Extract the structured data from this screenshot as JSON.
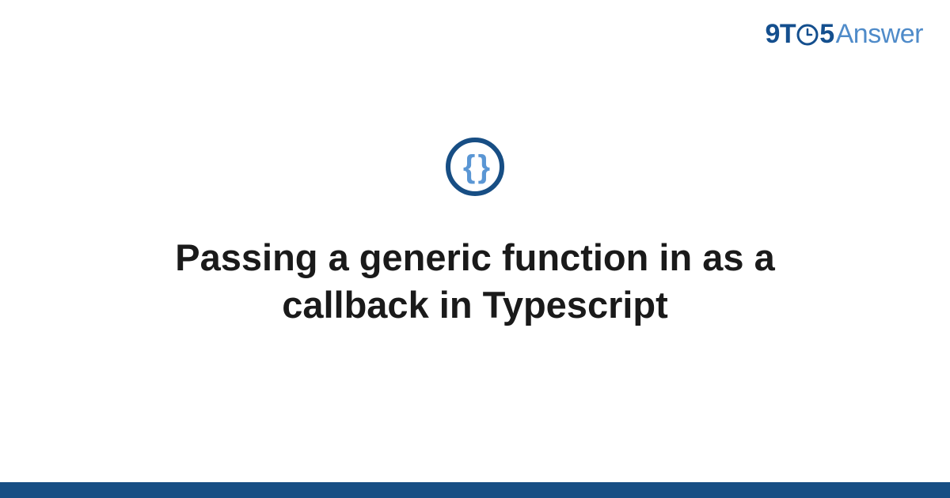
{
  "logo": {
    "part_nine": "9",
    "part_t": "T",
    "part_five": "5",
    "part_answer": "Answer"
  },
  "category_icon": {
    "symbol": "{ }",
    "name": "code-braces"
  },
  "title": "Passing a generic function in as a callback in Typescript",
  "colors": {
    "primary_dark": "#174e84",
    "primary_light": "#5a96d4",
    "logo_dark": "#144f8e",
    "logo_light": "#4f8bc9"
  }
}
